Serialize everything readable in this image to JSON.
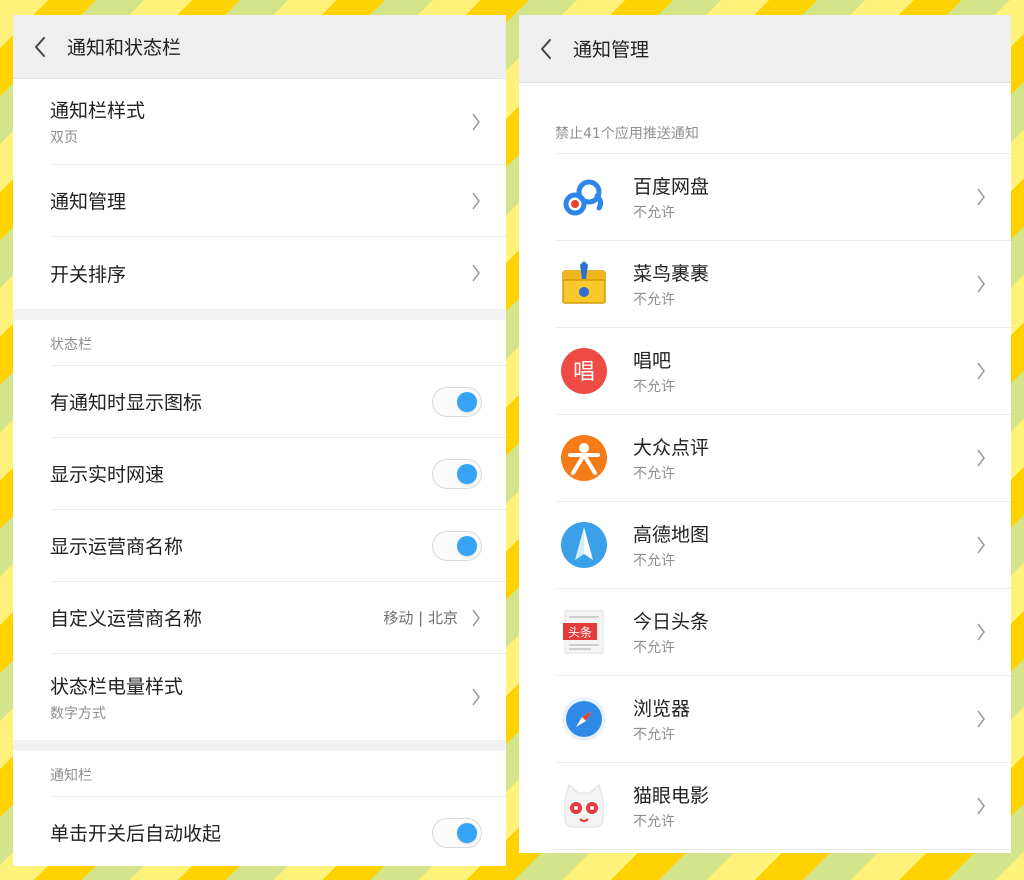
{
  "left": {
    "title": "通知和状态栏",
    "rows_top": [
      {
        "title": "通知栏样式",
        "sub": "双页"
      },
      {
        "title": "通知管理"
      },
      {
        "title": "开关排序"
      }
    ],
    "section_statusbar": "状态栏",
    "statusbar_rows": [
      {
        "title": "有通知时显示图标",
        "toggle": true
      },
      {
        "title": "显示实时网速",
        "toggle": true
      },
      {
        "title": "显示运营商名称",
        "toggle": true
      },
      {
        "title": "自定义运营商名称",
        "value": "移动 | 北京"
      },
      {
        "title": "状态栏电量样式",
        "sub": "数字方式"
      }
    ],
    "section_notifbar": "通知栏",
    "notifbar_rows": [
      {
        "title": "单击开关后自动收起",
        "toggle": true
      }
    ]
  },
  "right": {
    "title": "通知管理",
    "list_label": "禁止41个应用推送通知",
    "apps": [
      {
        "name": "百度网盘",
        "status": "不允许",
        "icon": "baidu-netdisk-icon"
      },
      {
        "name": "菜鸟裹裹",
        "status": "不允许",
        "icon": "cainiao-icon"
      },
      {
        "name": "唱吧",
        "status": "不允许",
        "icon": "changba-icon"
      },
      {
        "name": "大众点评",
        "status": "不允许",
        "icon": "dianping-icon"
      },
      {
        "name": "高德地图",
        "status": "不允许",
        "icon": "amap-icon"
      },
      {
        "name": "今日头条",
        "status": "不允许",
        "icon": "toutiao-icon"
      },
      {
        "name": "浏览器",
        "status": "不允许",
        "icon": "browser-icon"
      },
      {
        "name": "猫眼电影",
        "status": "不允许",
        "icon": "maoyan-icon"
      }
    ],
    "icon_text": {
      "changba": "唱",
      "toutiao": "头条"
    }
  },
  "colors": {
    "accent": "#36a4f4",
    "header_bg": "#efefef"
  }
}
